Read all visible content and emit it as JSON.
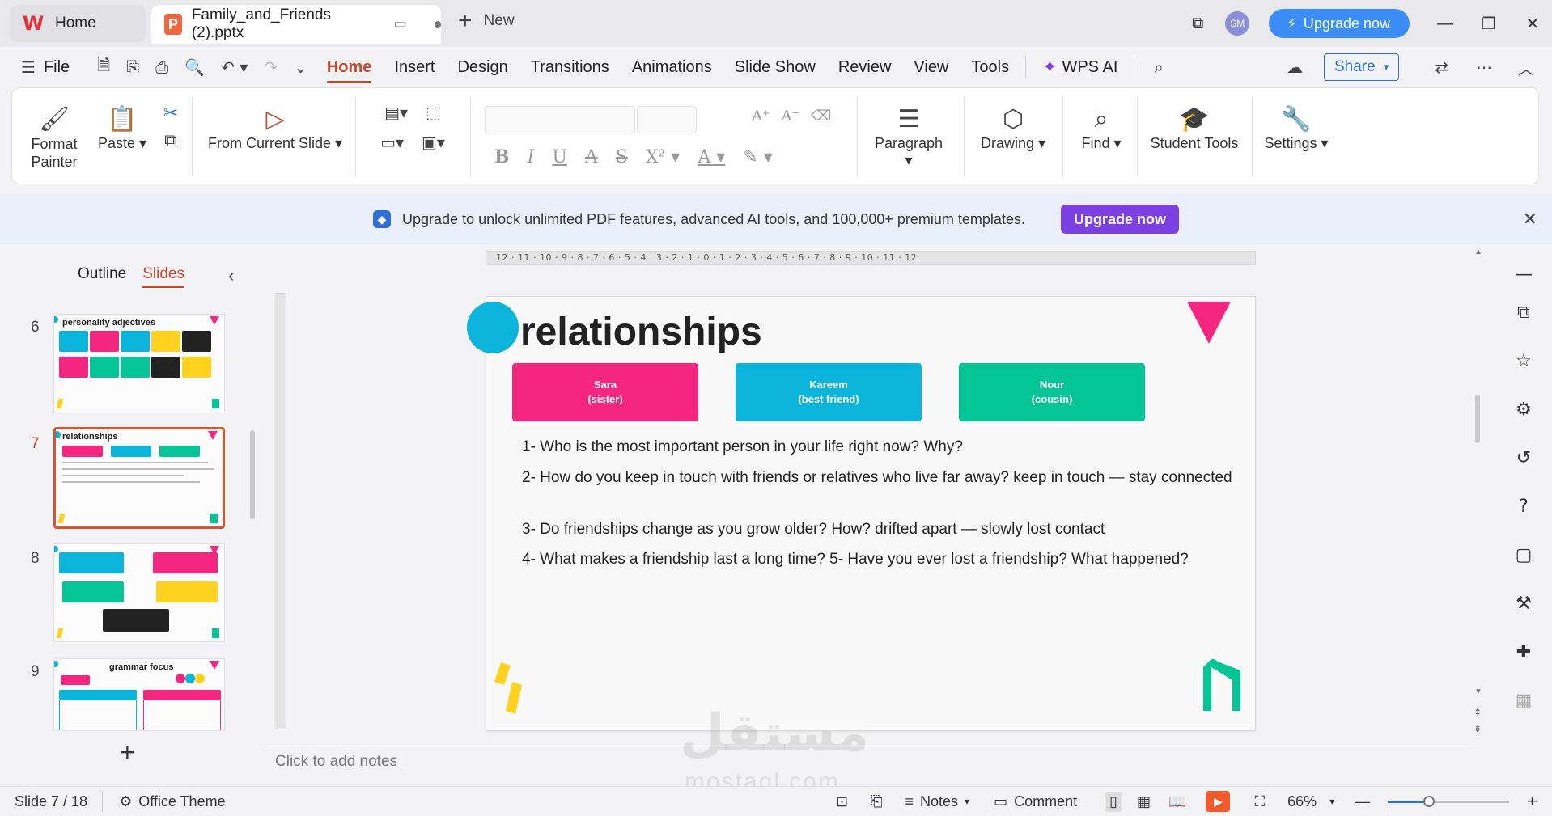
{
  "titlebar": {
    "home_tab": "Home",
    "doc_tab": "Family_and_Friends (2).pptx",
    "new_tab": "New",
    "avatar": "SM",
    "upgrade": "Upgrade now"
  },
  "menu": {
    "file": "File",
    "items": [
      "Home",
      "Insert",
      "Design",
      "Transitions",
      "Animations",
      "Slide Show",
      "Review",
      "View",
      "Tools"
    ],
    "active": "Home",
    "wps_ai": "WPS AI",
    "share": "Share"
  },
  "ribbon": {
    "format_painter": "Format\nPainter",
    "paste": "Paste",
    "from_current": "From Current Slide",
    "paragraph": "Paragraph",
    "drawing": "Drawing",
    "find": "Find",
    "student_tools": "Student Tools",
    "settings": "Settings"
  },
  "banner": {
    "text": "Upgrade to unlock unlimited PDF features, advanced AI tools, and 100,000+ premium templates.",
    "button": "Upgrade now"
  },
  "left_panel": {
    "tabs": [
      "Outline",
      "Slides"
    ],
    "active_tab": "Slides",
    "thumbs": [
      {
        "num": "6",
        "title": "personality adjectives"
      },
      {
        "num": "7",
        "title": "relationships"
      },
      {
        "num": "8",
        "title": ""
      },
      {
        "num": "9",
        "title": "grammar focus"
      }
    ]
  },
  "slide": {
    "title": "relationships",
    "boxes": [
      {
        "label": "Sara\n(sister)",
        "color": "#f5267f"
      },
      {
        "label": "Kareem\n(best friend)",
        "color": "#0bb4db"
      },
      {
        "label": "Nour\n(cousin)",
        "color": "#05c495"
      }
    ],
    "questions": [
      "1- Who is the most important person in your life right now? Why?",
      "2- How do you keep in touch with friends or relatives who live far away?   keep in touch — stay connected",
      "3- Do friendships change as you grow older? How?   drifted apart — slowly lost contact",
      "4- What makes a friendship last a long time?  5- Have you ever lost a friendship? What happened?"
    ]
  },
  "ruler": "12 · 11 · 10 · 9 · 8 · 7 · 6 · 5 · 4 · 3 · 2 · 1 · 0 · 1 · 2 · 3 · 4 · 5 · 6 · 7 · 8 · 9 · 10 · 11 · 12",
  "notes_placeholder": "Click to add notes",
  "status": {
    "slide_count": "Slide 7 / 18",
    "theme": "Office Theme",
    "notes": "Notes",
    "comment": "Comment",
    "zoom": "66%"
  },
  "watermark": {
    "arabic": "مستقل",
    "latin": "mostaql.com"
  }
}
